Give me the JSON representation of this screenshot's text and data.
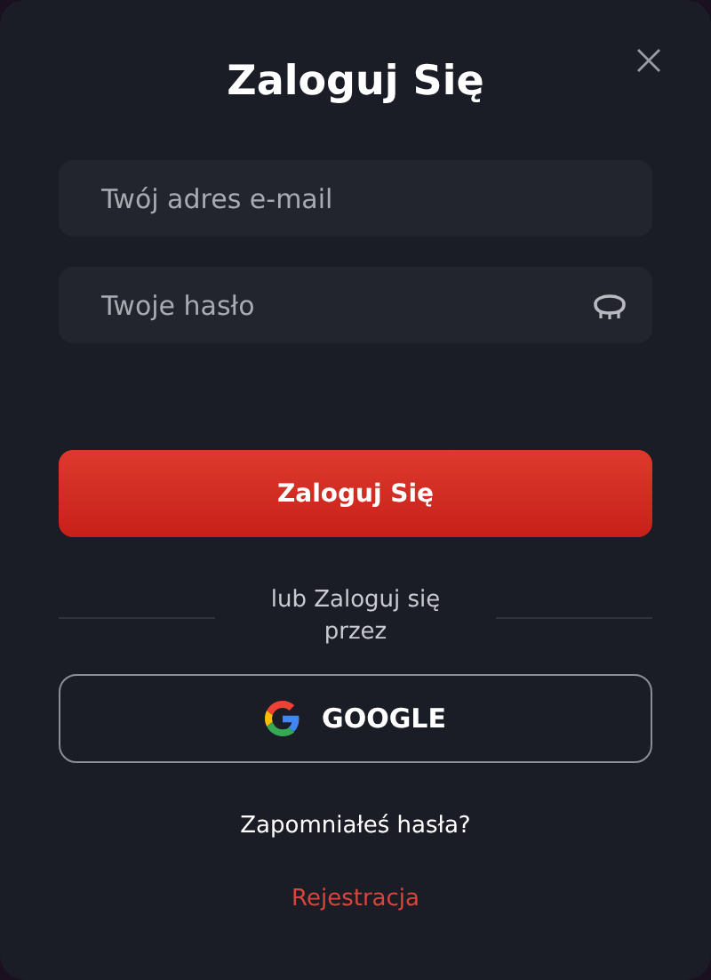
{
  "title": "Zaloguj Się",
  "fields": [
    {
      "kind": "email",
      "placeholder": "Twój adres e-mail"
    },
    {
      "kind": "password",
      "placeholder": "Twoje hasło"
    }
  ],
  "submit_button": "Zaloguj Się",
  "divider_text": "lub Zaloguj się przez",
  "google_button": "GOOGLE",
  "forgot_link": "Zapomniałeś hasła?",
  "register_link": "Rejestracja"
}
